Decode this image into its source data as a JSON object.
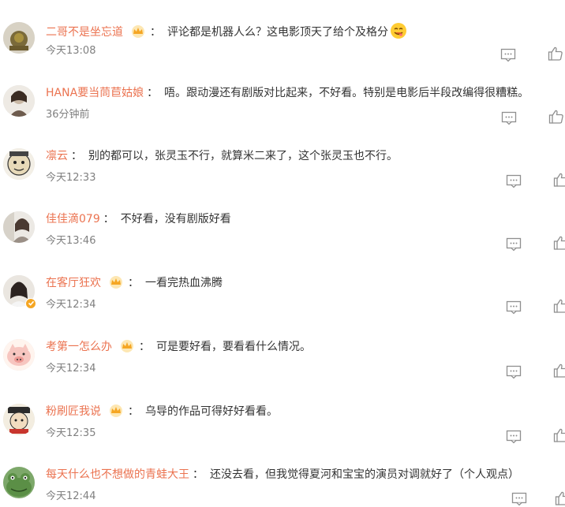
{
  "comments": [
    {
      "user": "二哥不是坐忘道",
      "crown": true,
      "text": "评论都是机器人么？这电影顶天了给个及格分",
      "emoji": true,
      "time": "今天13:08",
      "verified": false
    },
    {
      "user": "HANA要当茼苣姑娘",
      "crown": false,
      "text": "唔。跟动漫还有剧版对比起来，不好看。特别是电影后半段改编得很糟糕。",
      "emoji": false,
      "time": "36分钟前",
      "verified": false
    },
    {
      "user": "凛云",
      "crown": false,
      "text": "别的都可以，张灵玉不行，就算米二来了，这个张灵玉也不行。",
      "emoji": false,
      "time": "今天12:33",
      "verified": false
    },
    {
      "user": "佳佳滴079",
      "crown": false,
      "text": "不好看，没有剧版好看",
      "emoji": false,
      "time": "今天13:46",
      "verified": false
    },
    {
      "user": "在客厅狂欢",
      "crown": true,
      "text": "一看完热血沸腾",
      "emoji": false,
      "time": "今天12:34",
      "verified": true
    },
    {
      "user": "考第一怎么办",
      "crown": true,
      "text": "可是要好看，要看看什么情况。",
      "emoji": false,
      "time": "今天12:34",
      "verified": false
    },
    {
      "user": "粉刷匠我说",
      "crown": true,
      "text": "乌导的作品可得好好看看。",
      "emoji": false,
      "time": "今天12:35",
      "verified": false
    },
    {
      "user": "每天什么也不想做的青蛙大王",
      "crown": false,
      "text": "还没去看，但我觉得夏河和宝宝的演员对调就好了（个人观点）",
      "emoji": false,
      "time": "今天12:44",
      "verified": false
    }
  ],
  "icons": {
    "reply": "comment-bubble-icon",
    "like": "thumbs-up-icon",
    "crown": "crown-badge-icon",
    "emoji": "yummy-face-emoji"
  },
  "colors": {
    "username": "#eb7350",
    "text": "#333333",
    "time": "#808080",
    "crown": "#f5a623"
  }
}
